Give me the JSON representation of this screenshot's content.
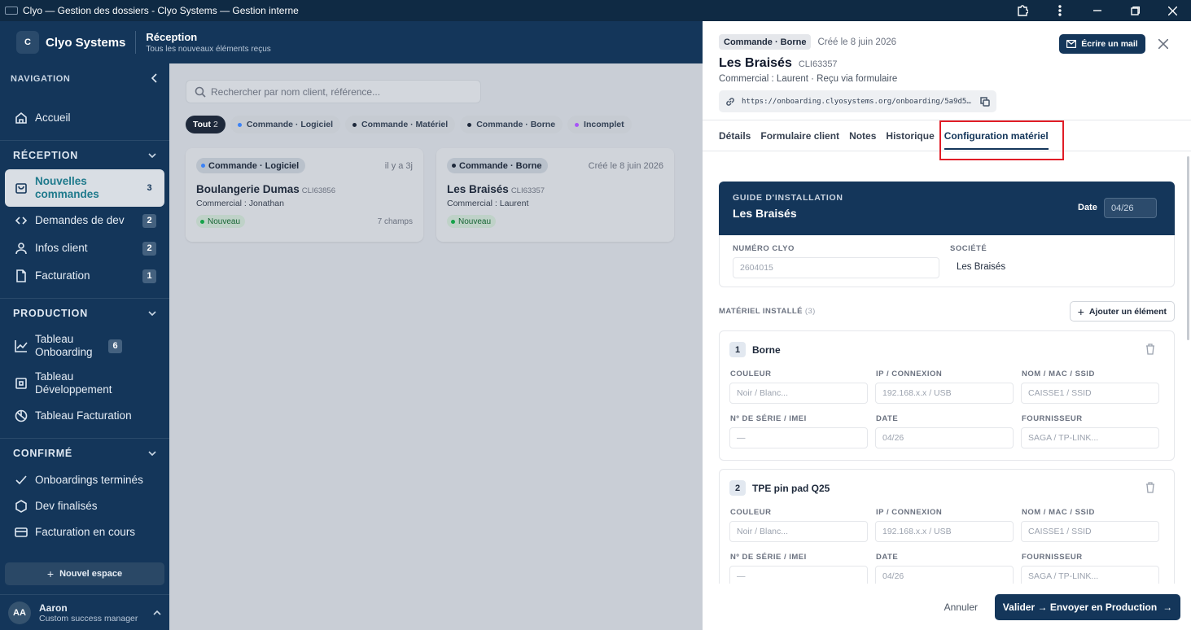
{
  "window": {
    "title": "Clyo — Gestion des dossiers - Clyo Systems — Gestion interne"
  },
  "header": {
    "logo_letter": "C",
    "brand": "Clyo Systems",
    "section_title": "Réception",
    "section_subtitle": "Tous les nouveaux éléments reçus"
  },
  "sidebar": {
    "nav_heading": "NAVIGATION",
    "home": "Accueil",
    "sections": [
      {
        "title": "RÉCEPTION",
        "items": [
          {
            "label": "Nouvelles commandes",
            "badge": "3"
          },
          {
            "label": "Demandes de dev",
            "badge": "2"
          },
          {
            "label": "Infos client",
            "badge": "2"
          },
          {
            "label": "Facturation",
            "badge": "1"
          }
        ]
      },
      {
        "title": "PRODUCTION",
        "items": [
          {
            "label": "Tableau Onboarding",
            "badge": "6"
          },
          {
            "label": "Tableau Développement",
            "badge": ""
          },
          {
            "label": "Tableau Facturation",
            "badge": ""
          }
        ]
      },
      {
        "title": "CONFIRMÉ",
        "items": [
          {
            "label": "Onboardings terminés"
          },
          {
            "label": "Dev finalisés"
          },
          {
            "label": "Facturation en cours"
          }
        ]
      }
    ],
    "new_space": "Nouvel espace",
    "user": {
      "initials": "AA",
      "name": "Aaron",
      "role": "Custom success manager"
    }
  },
  "main": {
    "search_placeholder": "Rechercher par nom client, référence...",
    "filters": [
      {
        "label": "Tout",
        "count": "2",
        "color": ""
      },
      {
        "label": "Commande · Logiciel",
        "color": "#3b82f6"
      },
      {
        "label": "Commande · Matériel",
        "color": "#1e293b"
      },
      {
        "label": "Commande · Borne",
        "color": "#1e293b"
      },
      {
        "label": "Incomplet",
        "color": "#a855f7"
      }
    ],
    "cards": [
      {
        "type": "Commande · Logiciel",
        "dot": "#3b82f6",
        "time": "il y a 3j",
        "name": "Boulangerie Dumas",
        "ref": "CLI63856",
        "commercial_label": "Commercial : ",
        "commercial": "Jonathan",
        "status": "Nouveau",
        "fields": "7 champs"
      },
      {
        "type": "Commande · Borne",
        "dot": "#1e293b",
        "time": "Créé le 8 juin 2026",
        "name": "Les Braisés",
        "ref": "CLI63357",
        "commercial_label": "Commercial : ",
        "commercial": "Laurent",
        "status": "Nouveau",
        "fields": ""
      }
    ]
  },
  "panel": {
    "tag": "Commande · Borne",
    "created": "Créé le 8 juin 2026",
    "title": "Les Braisés",
    "ref": "CLI63357",
    "subtitle": "Commercial : Laurent · Reçu via formulaire",
    "url": "https://onboarding.clyosystems.org/onboarding/5a9d5…",
    "mail_button": "Écrire un mail",
    "tabs": [
      "Détails",
      "Formulaire client",
      "Notes",
      "Historique",
      "Configuration matériel"
    ],
    "active_tab": 4,
    "guide": {
      "heading": "GUIDE D'INSTALLATION",
      "name": "Les Braisés",
      "date_label": "Date",
      "date_value": "04/26"
    },
    "info": {
      "numero_label": "NUMÉRO CLYO",
      "numero_value": "2604015",
      "societe_label": "SOCIÉTÉ",
      "societe_value": "Les Braisés"
    },
    "materiel": {
      "heading": "MATÉRIEL INSTALLÉ",
      "count": "(3)",
      "add_button": "Ajouter un élément"
    },
    "field_labels": {
      "couleur": "COULEUR",
      "ip": "IP / CONNEXION",
      "nom": "NOM / MAC / SSID",
      "serie": "Nº DE SÉRIE / IMEI",
      "date": "DATE",
      "fournisseur": "FOURNISSEUR"
    },
    "field_placeholders": {
      "couleur": "Noir / Blanc...",
      "ip": "192.168.x.x / USB",
      "nom": "CAISSE1 / SSID",
      "serie": "—",
      "date": "04/26",
      "fournisseur": "SAGA / TP-LINK..."
    },
    "items": [
      {
        "num": "1",
        "name": "Borne"
      },
      {
        "num": "2",
        "name": "TPE pin pad Q25"
      }
    ],
    "cancel": "Annuler",
    "validate": "Valider → Envoyer en Production"
  }
}
